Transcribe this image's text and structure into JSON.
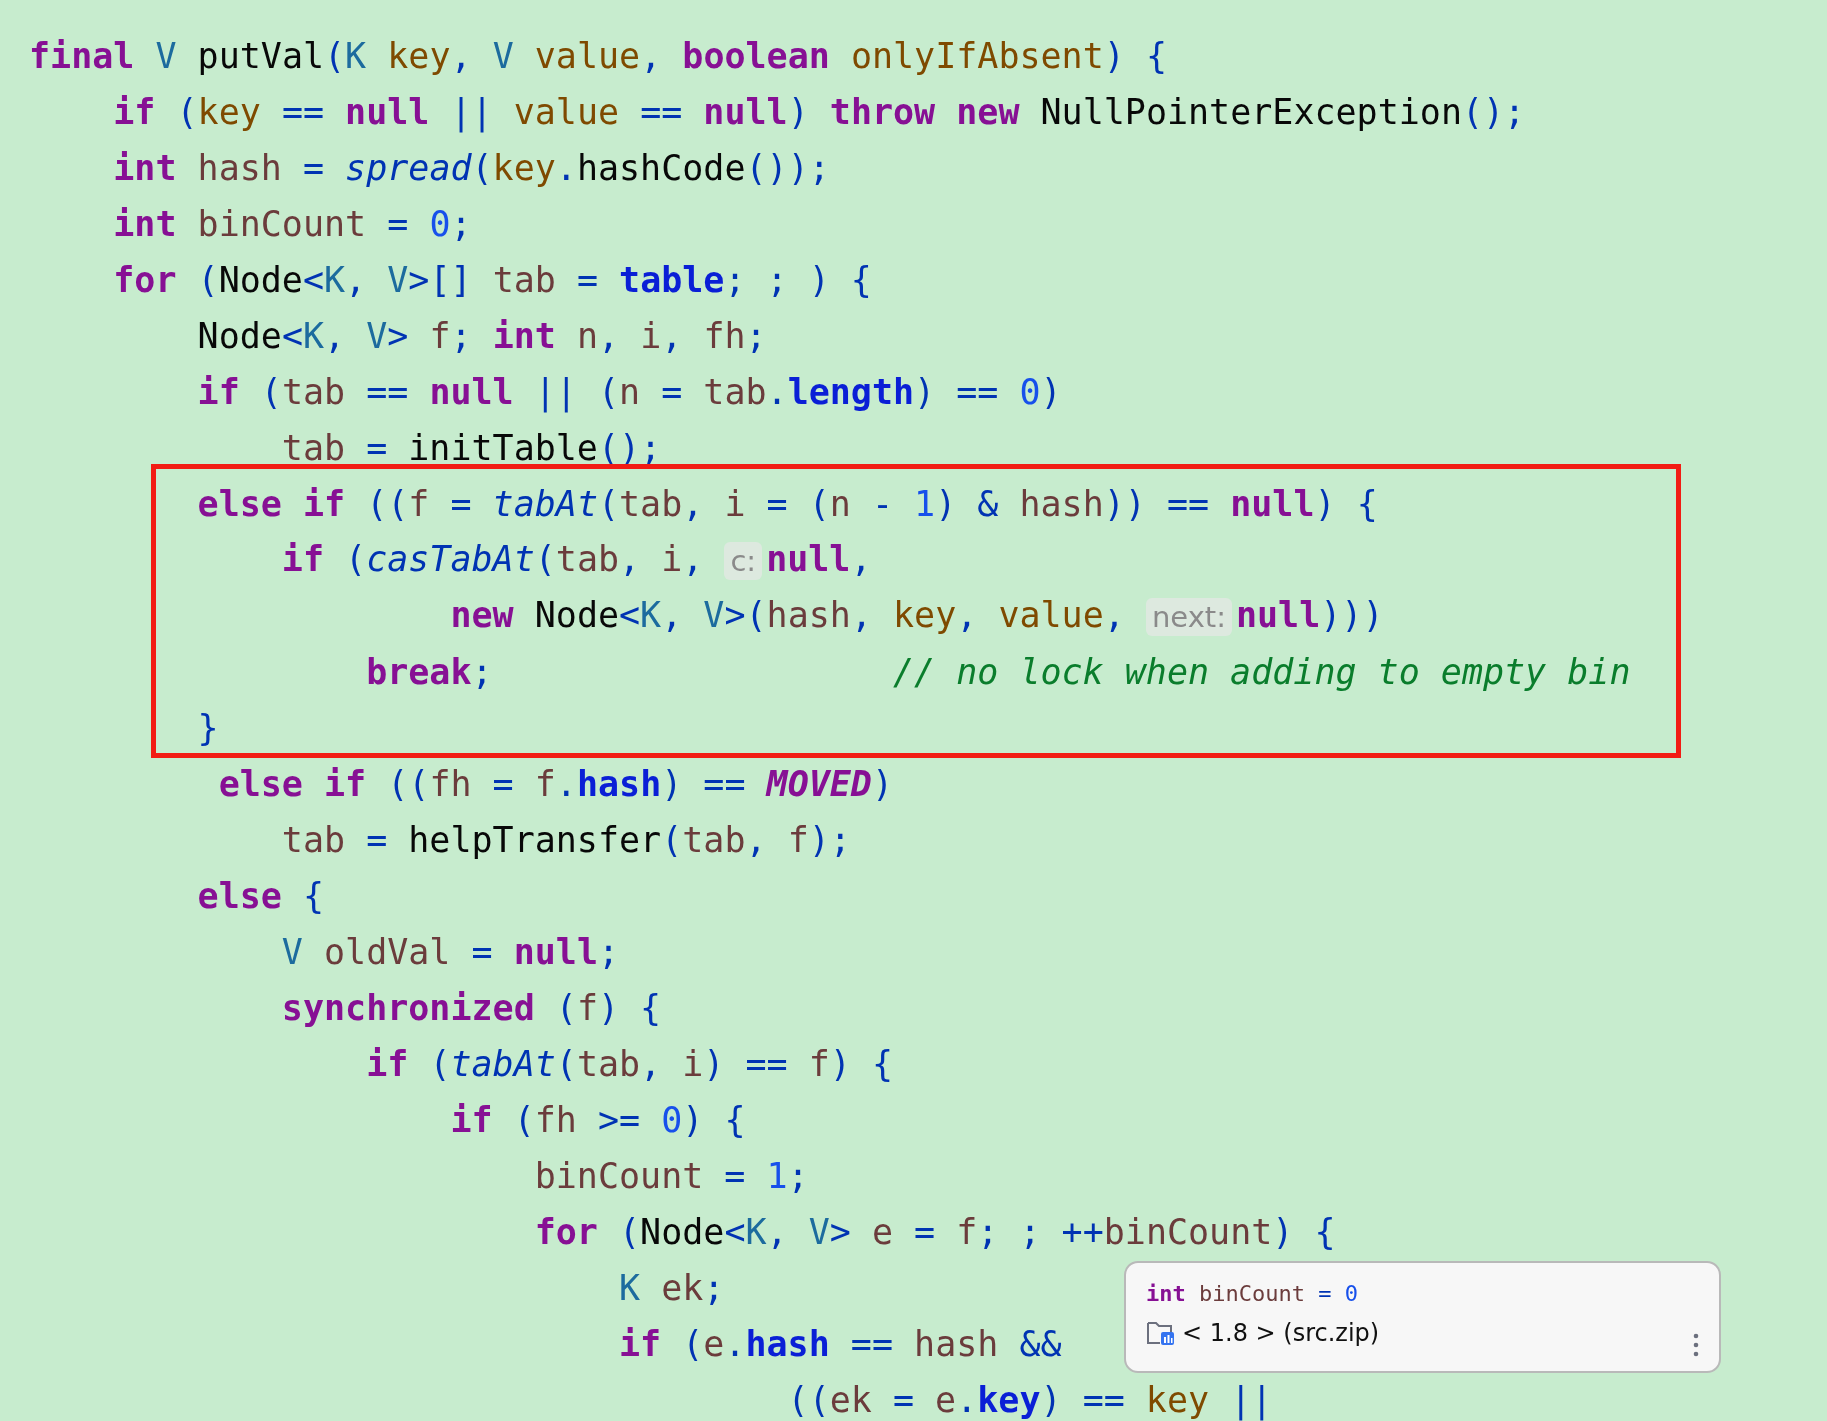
{
  "code_lines": [
    {
      "tokens": [
        {
          "kind": "kw",
          "text": "final "
        },
        {
          "kind": "type",
          "text": "V "
        },
        {
          "kind": "plain",
          "text": "putVal"
        },
        {
          "kind": "op",
          "text": "("
        },
        {
          "kind": "type",
          "text": "K "
        },
        {
          "kind": "param",
          "text": "key"
        },
        {
          "kind": "op",
          "text": ", "
        },
        {
          "kind": "type",
          "text": "V "
        },
        {
          "kind": "param",
          "text": "value"
        },
        {
          "kind": "op",
          "text": ", "
        },
        {
          "kind": "kw",
          "text": "boolean "
        },
        {
          "kind": "param",
          "text": "onlyIfAbsent"
        },
        {
          "kind": "op",
          "text": ") {"
        }
      ]
    },
    {
      "tokens": [
        {
          "kind": "kw",
          "text": "    if "
        },
        {
          "kind": "op",
          "text": "("
        },
        {
          "kind": "param",
          "text": "key"
        },
        {
          "kind": "op",
          "text": " == "
        },
        {
          "kind": "kw",
          "text": "null"
        },
        {
          "kind": "op",
          "text": " || "
        },
        {
          "kind": "param",
          "text": "value"
        },
        {
          "kind": "op",
          "text": " == "
        },
        {
          "kind": "kw",
          "text": "null"
        },
        {
          "kind": "op",
          "text": ") "
        },
        {
          "kind": "kw",
          "text": "throw new "
        },
        {
          "kind": "plain",
          "text": "NullPointerException"
        },
        {
          "kind": "op",
          "text": "();"
        }
      ]
    },
    {
      "tokens": [
        {
          "kind": "kw",
          "text": "    int "
        },
        {
          "kind": "local",
          "text": "hash"
        },
        {
          "kind": "op",
          "text": " = "
        },
        {
          "kind": "static",
          "text": "spread"
        },
        {
          "kind": "op",
          "text": "("
        },
        {
          "kind": "param",
          "text": "key"
        },
        {
          "kind": "op",
          "text": "."
        },
        {
          "kind": "plain",
          "text": "hashCode"
        },
        {
          "kind": "op",
          "text": "());"
        }
      ]
    },
    {
      "tokens": [
        {
          "kind": "kw",
          "text": "    int "
        },
        {
          "kind": "local",
          "text": "binCount"
        },
        {
          "kind": "op",
          "text": " = "
        },
        {
          "kind": "num",
          "text": "0"
        },
        {
          "kind": "op",
          "text": ";"
        }
      ]
    },
    {
      "tokens": [
        {
          "kind": "kw",
          "text": "    for "
        },
        {
          "kind": "op",
          "text": "("
        },
        {
          "kind": "plain",
          "text": "Node"
        },
        {
          "kind": "op",
          "text": "<"
        },
        {
          "kind": "type",
          "text": "K"
        },
        {
          "kind": "op",
          "text": ", "
        },
        {
          "kind": "type",
          "text": "V"
        },
        {
          "kind": "op",
          "text": ">[] "
        },
        {
          "kind": "local",
          "text": "tab"
        },
        {
          "kind": "op",
          "text": " = "
        },
        {
          "kind": "field",
          "text": "table"
        },
        {
          "kind": "op",
          "text": "; ; ) {"
        }
      ]
    },
    {
      "tokens": [
        {
          "kind": "plain",
          "text": "        Node"
        },
        {
          "kind": "op",
          "text": "<"
        },
        {
          "kind": "type",
          "text": "K"
        },
        {
          "kind": "op",
          "text": ", "
        },
        {
          "kind": "type",
          "text": "V"
        },
        {
          "kind": "op",
          "text": "> "
        },
        {
          "kind": "local",
          "text": "f"
        },
        {
          "kind": "op",
          "text": "; "
        },
        {
          "kind": "kw",
          "text": "int "
        },
        {
          "kind": "local",
          "text": "n"
        },
        {
          "kind": "op",
          "text": ", "
        },
        {
          "kind": "local",
          "text": "i"
        },
        {
          "kind": "op",
          "text": ", "
        },
        {
          "kind": "local",
          "text": "fh"
        },
        {
          "kind": "op",
          "text": ";"
        }
      ]
    },
    {
      "tokens": [
        {
          "kind": "kw",
          "text": "        if "
        },
        {
          "kind": "op",
          "text": "("
        },
        {
          "kind": "local",
          "text": "tab"
        },
        {
          "kind": "op",
          "text": " == "
        },
        {
          "kind": "kw",
          "text": "null"
        },
        {
          "kind": "op",
          "text": " || ("
        },
        {
          "kind": "local",
          "text": "n"
        },
        {
          "kind": "op",
          "text": " = "
        },
        {
          "kind": "local",
          "text": "tab"
        },
        {
          "kind": "op",
          "text": "."
        },
        {
          "kind": "field",
          "text": "length"
        },
        {
          "kind": "op",
          "text": ") == "
        },
        {
          "kind": "num",
          "text": "0"
        },
        {
          "kind": "op",
          "text": ")"
        }
      ]
    },
    {
      "tokens": [
        {
          "kind": "local",
          "text": "            tab"
        },
        {
          "kind": "op",
          "text": " = "
        },
        {
          "kind": "plain",
          "text": "initTable"
        },
        {
          "kind": "op",
          "text": "();"
        }
      ]
    }
  ],
  "highlighted_lines": [
    {
      "tokens": [
        {
          "kind": "kw",
          "text": "        else if "
        },
        {
          "kind": "op",
          "text": "(("
        },
        {
          "kind": "local",
          "text": "f"
        },
        {
          "kind": "op",
          "text": " = "
        },
        {
          "kind": "static",
          "text": "tabAt"
        },
        {
          "kind": "op",
          "text": "("
        },
        {
          "kind": "local",
          "text": "tab"
        },
        {
          "kind": "op",
          "text": ", "
        },
        {
          "kind": "local",
          "text": "i"
        },
        {
          "kind": "op",
          "text": " = ("
        },
        {
          "kind": "local",
          "text": "n"
        },
        {
          "kind": "op",
          "text": " - "
        },
        {
          "kind": "num",
          "text": "1"
        },
        {
          "kind": "op",
          "text": ") & "
        },
        {
          "kind": "local",
          "text": "hash"
        },
        {
          "kind": "op",
          "text": ")) == "
        },
        {
          "kind": "kw",
          "text": "null"
        },
        {
          "kind": "op",
          "text": ") {"
        }
      ]
    },
    {
      "tokens": [
        {
          "kind": "kw",
          "text": "            if "
        },
        {
          "kind": "op",
          "text": "("
        },
        {
          "kind": "static",
          "text": "casTabAt"
        },
        {
          "kind": "op",
          "text": "("
        },
        {
          "kind": "local",
          "text": "tab"
        },
        {
          "kind": "op",
          "text": ", "
        },
        {
          "kind": "local",
          "text": "i"
        },
        {
          "kind": "op",
          "text": ", "
        },
        {
          "kind": "hint",
          "text": "c:"
        },
        {
          "kind": "kw",
          "text": "null"
        },
        {
          "kind": "op",
          "text": ","
        }
      ]
    },
    {
      "tokens": [
        {
          "kind": "kw",
          "text": "                    new "
        },
        {
          "kind": "plain",
          "text": "Node"
        },
        {
          "kind": "op",
          "text": "<"
        },
        {
          "kind": "type",
          "text": "K"
        },
        {
          "kind": "op",
          "text": ", "
        },
        {
          "kind": "type",
          "text": "V"
        },
        {
          "kind": "op",
          "text": ">("
        },
        {
          "kind": "local",
          "text": "hash"
        },
        {
          "kind": "op",
          "text": ", "
        },
        {
          "kind": "param",
          "text": "key"
        },
        {
          "kind": "op",
          "text": ", "
        },
        {
          "kind": "param",
          "text": "value"
        },
        {
          "kind": "op",
          "text": ", "
        },
        {
          "kind": "hint",
          "text": "next:"
        },
        {
          "kind": "kw",
          "text": "null"
        },
        {
          "kind": "op",
          "text": ")))"
        }
      ]
    },
    {
      "tokens": [
        {
          "kind": "kw",
          "text": "                break"
        },
        {
          "kind": "op",
          "text": ";                   "
        },
        {
          "kind": "comment",
          "text": "// no lock when adding to empty bin"
        }
      ]
    },
    {
      "tokens": [
        {
          "kind": "op",
          "text": "        }"
        }
      ]
    }
  ],
  "more_code_lines": [
    {
      "tokens": [
        {
          "kind": "kw",
          "text": "         else if "
        },
        {
          "kind": "op",
          "text": "(("
        },
        {
          "kind": "local",
          "text": "fh"
        },
        {
          "kind": "op",
          "text": " = "
        },
        {
          "kind": "local",
          "text": "f"
        },
        {
          "kind": "op",
          "text": "."
        },
        {
          "kind": "field",
          "text": "hash"
        },
        {
          "kind": "op",
          "text": ") == "
        },
        {
          "kind": "const",
          "text": "MOVED"
        },
        {
          "kind": "op",
          "text": ")"
        }
      ]
    },
    {
      "tokens": [
        {
          "kind": "local",
          "text": "            tab"
        },
        {
          "kind": "op",
          "text": " = "
        },
        {
          "kind": "plain",
          "text": "helpTransfer"
        },
        {
          "kind": "op",
          "text": "("
        },
        {
          "kind": "local",
          "text": "tab"
        },
        {
          "kind": "op",
          "text": ", "
        },
        {
          "kind": "local",
          "text": "f"
        },
        {
          "kind": "op",
          "text": ");"
        }
      ]
    },
    {
      "tokens": [
        {
          "kind": "kw",
          "text": "        else "
        },
        {
          "kind": "op",
          "text": "{"
        }
      ]
    },
    {
      "tokens": [
        {
          "kind": "type",
          "text": "            V "
        },
        {
          "kind": "local",
          "text": "oldVal"
        },
        {
          "kind": "op",
          "text": " = "
        },
        {
          "kind": "kw",
          "text": "null"
        },
        {
          "kind": "op",
          "text": ";"
        }
      ]
    },
    {
      "tokens": [
        {
          "kind": "kw",
          "text": "            synchronized "
        },
        {
          "kind": "op",
          "text": "("
        },
        {
          "kind": "local",
          "text": "f"
        },
        {
          "kind": "op",
          "text": ") {"
        }
      ]
    },
    {
      "tokens": [
        {
          "kind": "kw",
          "text": "                if "
        },
        {
          "kind": "op",
          "text": "("
        },
        {
          "kind": "static",
          "text": "tabAt"
        },
        {
          "kind": "op",
          "text": "("
        },
        {
          "kind": "local",
          "text": "tab"
        },
        {
          "kind": "op",
          "text": ", "
        },
        {
          "kind": "local",
          "text": "i"
        },
        {
          "kind": "op",
          "text": ") == "
        },
        {
          "kind": "local",
          "text": "f"
        },
        {
          "kind": "op",
          "text": ") {"
        }
      ]
    },
    {
      "tokens": [
        {
          "kind": "kw",
          "text": "                    if "
        },
        {
          "kind": "op",
          "text": "("
        },
        {
          "kind": "local",
          "text": "fh"
        },
        {
          "kind": "op",
          "text": " >= "
        },
        {
          "kind": "num",
          "text": "0"
        },
        {
          "kind": "op",
          "text": ") {"
        }
      ]
    },
    {
      "tokens": [
        {
          "kind": "local",
          "text": "                        binCount"
        },
        {
          "kind": "op",
          "text": " = "
        },
        {
          "kind": "num",
          "text": "1"
        },
        {
          "kind": "op",
          "text": ";"
        }
      ]
    },
    {
      "tokens": [
        {
          "kind": "kw",
          "text": "                        for "
        },
        {
          "kind": "op",
          "text": "("
        },
        {
          "kind": "plain",
          "text": "Node"
        },
        {
          "kind": "op",
          "text": "<"
        },
        {
          "kind": "type",
          "text": "K"
        },
        {
          "kind": "op",
          "text": ", "
        },
        {
          "kind": "type",
          "text": "V"
        },
        {
          "kind": "op",
          "text": "> "
        },
        {
          "kind": "local",
          "text": "e"
        },
        {
          "kind": "op",
          "text": " = "
        },
        {
          "kind": "local",
          "text": "f"
        },
        {
          "kind": "op",
          "text": "; ; ++"
        },
        {
          "kind": "local",
          "text": "binCount"
        },
        {
          "kind": "op",
          "text": ") {"
        }
      ]
    },
    {
      "tokens": [
        {
          "kind": "type",
          "text": "                            K "
        },
        {
          "kind": "local",
          "text": "ek"
        },
        {
          "kind": "op",
          "text": ";"
        }
      ]
    },
    {
      "tokens": [
        {
          "kind": "kw",
          "text": "                            if "
        },
        {
          "kind": "op",
          "text": "("
        },
        {
          "kind": "local",
          "text": "e"
        },
        {
          "kind": "op",
          "text": "."
        },
        {
          "kind": "field",
          "text": "hash"
        },
        {
          "kind": "op",
          "text": " == "
        },
        {
          "kind": "local",
          "text": "hash"
        },
        {
          "kind": "op",
          "text": " &&"
        }
      ]
    },
    {
      "tokens": [
        {
          "kind": "op",
          "text": "                                    (("
        },
        {
          "kind": "local",
          "text": "ek"
        },
        {
          "kind": "op",
          "text": " = "
        },
        {
          "kind": "local",
          "text": "e"
        },
        {
          "kind": "op",
          "text": "."
        },
        {
          "kind": "field",
          "text": "key"
        },
        {
          "kind": "op",
          "text": ") == "
        },
        {
          "kind": "param",
          "text": "key"
        },
        {
          "kind": "op",
          "text": " ||"
        }
      ]
    }
  ],
  "tooltip": {
    "signature": [
      {
        "kind": "kw",
        "text": "int "
      },
      {
        "kind": "local",
        "text": "binCount"
      },
      {
        "kind": "op",
        "text": " = "
      },
      {
        "kind": "num",
        "text": "0"
      }
    ],
    "source": "< 1.8 > (src.zip)"
  }
}
